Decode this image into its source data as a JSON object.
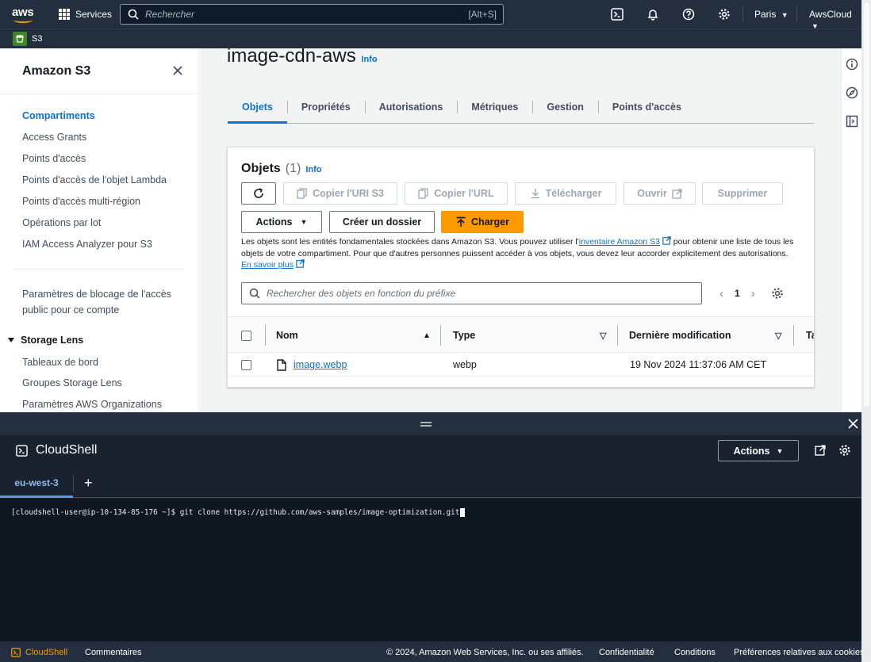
{
  "topnav": {
    "logo_text": "aws",
    "services_label": "Services",
    "search_placeholder": "Rechercher",
    "search_shortcut": "[Alt+S]",
    "region_label": "Paris",
    "account_label": "AwsCloud",
    "icons": [
      "cloudshell-icon",
      "bell-icon",
      "help-icon",
      "gear-icon"
    ]
  },
  "subnav": {
    "service_label": "S3"
  },
  "sidebar": {
    "title": "Amazon S3",
    "items": [
      {
        "label": "Compartiments",
        "active": true
      },
      {
        "label": "Access Grants"
      },
      {
        "label": "Points d'accès"
      },
      {
        "label": "Points d'accès de l'objet Lambda"
      },
      {
        "label": "Points d'accès multi-région"
      },
      {
        "label": "Opérations par lot"
      },
      {
        "label": "IAM Access Analyzer pour S3"
      }
    ],
    "block_access": {
      "line1": "Paramètres de blocage de l'accès",
      "line2": "public pour ce compte"
    },
    "storage_lens": {
      "title": "Storage Lens",
      "items": [
        {
          "label": "Tableaux de bord"
        },
        {
          "label": "Groupes Storage Lens"
        },
        {
          "label": "Paramètres AWS Organizations"
        }
      ]
    }
  },
  "main": {
    "bucket_name": "image-cdn-aws",
    "info_label": "Info",
    "tabs": [
      {
        "label": "Objets",
        "active": true
      },
      {
        "label": "Propriétés"
      },
      {
        "label": "Autorisations"
      },
      {
        "label": "Métriques"
      },
      {
        "label": "Gestion"
      },
      {
        "label": "Points d'accès"
      }
    ],
    "objects": {
      "title": "Objets",
      "count": "(1)",
      "info_label": "Info",
      "buttons": {
        "copy_uri": "Copier l'URI S3",
        "copy_url": "Copier l'URL",
        "download": "Télécharger",
        "open": "Ouvrir",
        "delete": "Supprimer",
        "actions": "Actions",
        "create_folder": "Créer un dossier",
        "upload": "Charger"
      },
      "description": {
        "part1": "Les objets sont les entités fondamentales stockées dans Amazon S3. Vous pouvez utiliser l'",
        "link1": "inventaire Amazon S3",
        "part2": " pour obtenir une liste de tous les objets de votre compartiment. Pour que d'autres personnes puissent accéder à vos objets, vous devez leur accorder explicitement des autorisations. ",
        "link2": "En savoir plus"
      },
      "search_placeholder": "Rechercher des objets en fonction du préfixe",
      "page_number": "1",
      "columns": {
        "name": "Nom",
        "type": "Type",
        "modified": "Dernière modification",
        "size": "Ta"
      },
      "rows": [
        {
          "name": "image.webp",
          "type": "webp",
          "modified": "19 Nov 2024 11:37:06 AM CET"
        }
      ]
    }
  },
  "cloudshell": {
    "title": "CloudShell",
    "actions_label": "Actions",
    "tab_label": "eu-west-3",
    "add_tab_label": "+",
    "terminal_line": "[cloudshell-user@ip-10-134-85-176 ~]$ git clone https://github.com/aws-samples/image-optimization.git"
  },
  "footer": {
    "cloudshell_label": "CloudShell",
    "feedback_label": "Commentaires",
    "copyright": "© 2024, Amazon Web Services, Inc. ou ses affiliés.",
    "privacy": "Confidentialité",
    "terms": "Conditions",
    "cookies": "Préférences relatives aux cookies"
  },
  "colors": {
    "nav_bg": "#232f3e",
    "link": "#0972d3",
    "primary_button": "#ff9900",
    "s3_badge": "#3f8624",
    "footer_cloudshell": "#ff9900"
  }
}
